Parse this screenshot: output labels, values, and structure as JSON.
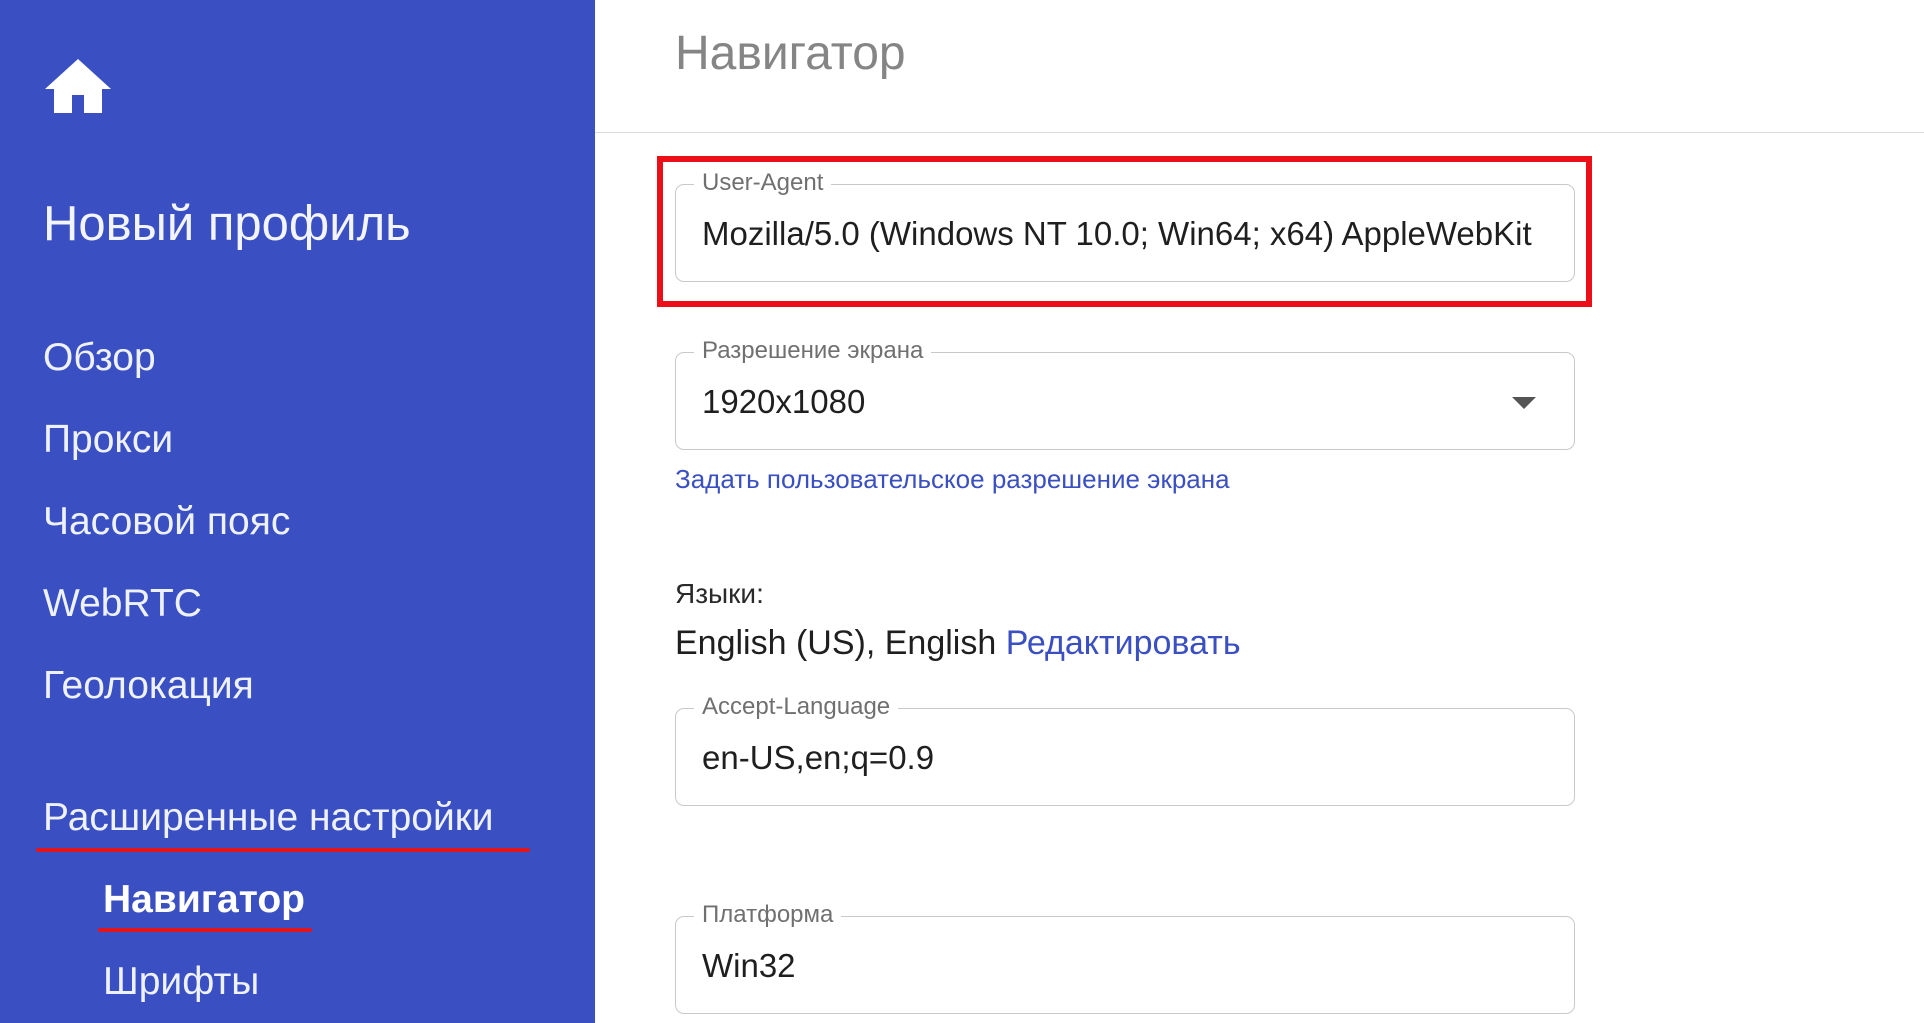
{
  "sidebar": {
    "home_icon": "home-icon",
    "profile_title": "Новый профиль",
    "items": [
      {
        "label": "Обзор"
      },
      {
        "label": "Прокси"
      },
      {
        "label": "Часовой пояс"
      },
      {
        "label": "WebRTC"
      },
      {
        "label": "Геолокация"
      }
    ],
    "advanced_label": "Расширенные настройки",
    "sub_items": [
      {
        "label": "Навигатор",
        "active": true
      },
      {
        "label": "Шрифты",
        "active": false
      }
    ]
  },
  "main": {
    "page_title": "Навигатор",
    "user_agent": {
      "label": "User-Agent",
      "value": "Mozilla/5.0 (Windows NT 10.0; Win64; x64) AppleWebKit"
    },
    "screen_resolution": {
      "label": "Разрешение экрана",
      "value": "1920x1080"
    },
    "custom_resolution_link": "Задать пользовательское разрешение экрана",
    "languages": {
      "label": "Языки:",
      "value": "English (US), English",
      "edit_link": "Редактировать"
    },
    "accept_language": {
      "label": "Accept-Language",
      "value": "en-US,en;q=0.9"
    },
    "platform": {
      "label": "Платформа",
      "value": "Win32"
    }
  },
  "colors": {
    "sidebar_bg": "#3a4fc2",
    "accent_link": "#3a4fc2",
    "highlight_red": "#ec0f18"
  }
}
